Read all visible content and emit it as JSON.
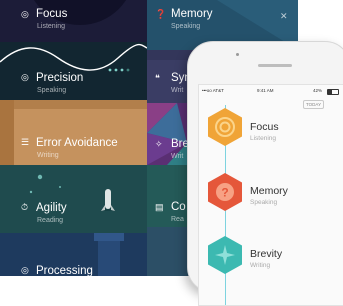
{
  "games": [
    {
      "name": "Focus",
      "skill": "Listening",
      "icon": "target-icon",
      "color": "#1c1c38"
    },
    {
      "name": "Precision",
      "skill": "Speaking",
      "icon": "target-icon",
      "color": "#122631"
    },
    {
      "name": "Error Avoidance",
      "skill": "Writing",
      "icon": "stack-icon",
      "color": "#c5925e"
    },
    {
      "name": "Agility",
      "skill": "Reading",
      "icon": "stopwatch-icon",
      "color": "#1f4b4e"
    },
    {
      "name": "Processing",
      "skill": "",
      "icon": "dial-icon",
      "color": "#1e3a5e"
    }
  ],
  "right_column": [
    {
      "name": "Memory",
      "skill": "Speaking",
      "icon": "question-icon",
      "color": "#24516b"
    },
    {
      "name": "Syn",
      "skill": "Writ",
      "icon": "quote-icon",
      "color": "#3a3d64"
    },
    {
      "name": "Bre",
      "skill": "Writ",
      "icon": "sparkle-icon",
      "color": "#5a2f73"
    },
    {
      "name": "Co",
      "skill": "Rea",
      "icon": "book-icon",
      "color": "#245a58"
    }
  ],
  "phone": {
    "carrier": "•••oo AT&T",
    "time": "9:41 AM",
    "battery": "42%",
    "today_label": "TODAY",
    "timeline": [
      {
        "name": "Focus",
        "skill": "Listening",
        "icon": "target-icon",
        "color": "#f0a437",
        "accent": "#fbd48a"
      },
      {
        "name": "Memory",
        "skill": "Speaking",
        "icon": "question-icon",
        "color": "#e5573a",
        "accent": "#f7a184"
      },
      {
        "name": "Brevity",
        "skill": "Writing",
        "icon": "sparkle-icon",
        "color": "#3cb9b1",
        "accent": "#8fe0d9"
      }
    ]
  }
}
